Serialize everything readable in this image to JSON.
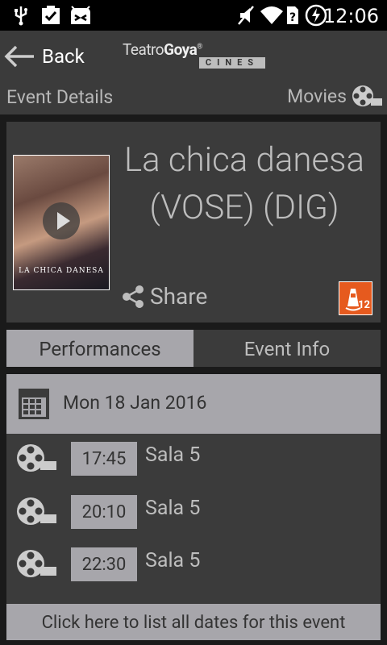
{
  "status_bar": {
    "time": "12:06",
    "left_icons": [
      "usb-icon",
      "clipboard-check-icon",
      "android-debug-icon"
    ],
    "right_icons": [
      "mute-icon",
      "wifi-icon",
      "no-sim-icon",
      "battery-charging-icon"
    ]
  },
  "header": {
    "back_label": "Back",
    "logo_text_light": "Teatro",
    "logo_text_bold": "Goya",
    "logo_mark": "®",
    "logo_sub": "CINES",
    "section_title": "Event Details",
    "movies_label": "Movies"
  },
  "event": {
    "title": "La chica danesa (VOSE) (DIG)",
    "poster_title": "LA CHICA DANESA",
    "share_label": "Share",
    "age_rating": "12"
  },
  "tabs": [
    {
      "label": "Performances",
      "active": true
    },
    {
      "label": "Event Info",
      "active": false
    }
  ],
  "performances": {
    "date": "Mon 18 Jan 2016",
    "shows": [
      {
        "time": "17:45",
        "room": "Sala 5"
      },
      {
        "time": "20:10",
        "room": "Sala 5"
      },
      {
        "time": "22:30",
        "room": "Sala 5"
      }
    ],
    "all_dates_label": "Click here to list all dates for this event"
  },
  "colors": {
    "background": "#1a1a1a",
    "panel": "#3b3b3b",
    "light_panel": "#a7a6ab",
    "text_light": "#bdbdbd",
    "rating_orange": "#e65a1e"
  }
}
